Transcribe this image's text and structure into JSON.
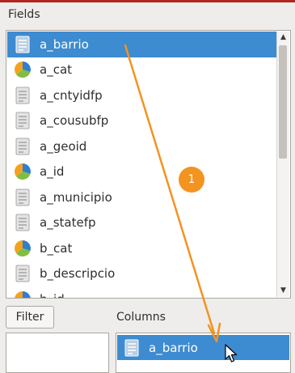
{
  "fields": {
    "label": "Fields",
    "items": [
      {
        "label": "a_barrio",
        "icon": "text-field-icon",
        "selected": true
      },
      {
        "label": "a_cat",
        "icon": "categorized-field-icon"
      },
      {
        "label": "a_cntyidfp",
        "icon": "text-field-icon"
      },
      {
        "label": "a_cousubfp",
        "icon": "text-field-icon"
      },
      {
        "label": "a_geoid",
        "icon": "text-field-icon"
      },
      {
        "label": "a_id",
        "icon": "categorized-field-icon"
      },
      {
        "label": "a_municipio",
        "icon": "text-field-icon"
      },
      {
        "label": "a_statefp",
        "icon": "text-field-icon"
      },
      {
        "label": "b_cat",
        "icon": "categorized-field-icon"
      },
      {
        "label": "b_descripcio",
        "icon": "text-field-icon"
      },
      {
        "label": "b_id",
        "icon": "categorized-field-icon"
      }
    ]
  },
  "filter": {
    "button_label": "Filter"
  },
  "columns": {
    "label": "Columns",
    "items": [
      {
        "label": "a_barrio",
        "icon": "text-field-icon",
        "selected": true
      }
    ]
  },
  "annotation": {
    "step": "1"
  },
  "colors": {
    "selection": "#3d8bd0",
    "annotation_orange": "#f39320",
    "text_icon_gray": "#d9d9d9",
    "pie_blue": "#2f7fd1",
    "pie_green": "#7fbf3f",
    "pie_orange": "#f4a21e"
  }
}
